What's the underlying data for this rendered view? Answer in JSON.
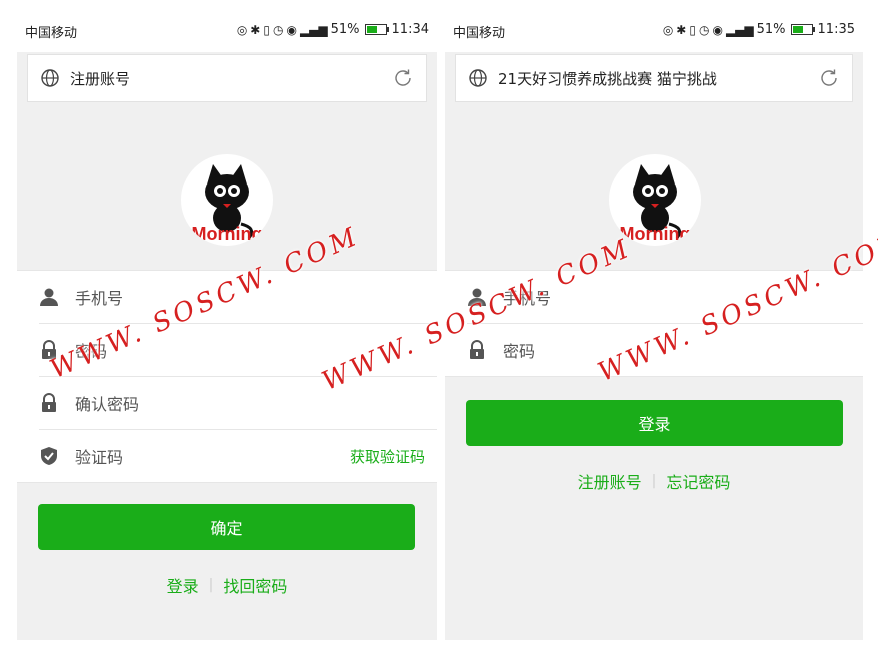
{
  "status_bar": {
    "carrier": "中国移动",
    "left_phone": {
      "battery": "51%",
      "time": "11:34"
    },
    "right_phone": {
      "battery": "51%",
      "time": "11:35"
    },
    "network": "4G"
  },
  "left_screen": {
    "title": "注册账号",
    "avatar_text": "Morning",
    "fields": [
      {
        "label": "手机号",
        "icon": "user-icon"
      },
      {
        "label": "密码",
        "icon": "lock-icon"
      },
      {
        "label": "确认密码",
        "icon": "lock-icon"
      },
      {
        "label": "验证码",
        "icon": "shield-icon"
      }
    ],
    "get_code_label": "获取验证码",
    "confirm_label": "确定",
    "links": {
      "login": "登录",
      "find_password": "找回密码"
    }
  },
  "right_screen": {
    "title": "21天好习惯养成挑战赛 猫宁挑战",
    "avatar_text": "Morning",
    "fields": [
      {
        "label": "手机号",
        "icon": "user-icon"
      },
      {
        "label": "密码",
        "icon": "lock-icon"
      }
    ],
    "login_label": "登录",
    "links": {
      "register": "注册账号",
      "forgot_password": "忘记密码"
    }
  },
  "watermark": "WWW. SOSCW. COM",
  "colors": {
    "accent": "#1aad19",
    "background": "#f0f0f0",
    "watermark": "#d62020"
  }
}
